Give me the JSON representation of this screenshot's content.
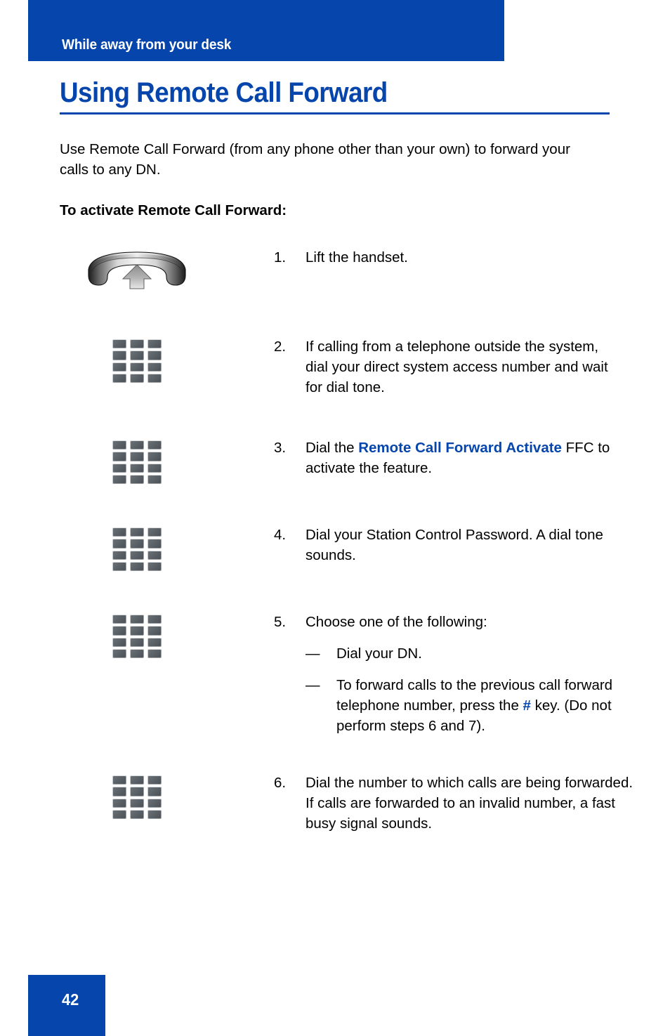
{
  "header": {
    "section_label": "While away from your desk",
    "bar_color": "#0645ab"
  },
  "title": {
    "text": "Using Remote Call Forward",
    "color": "#0645ab"
  },
  "intro": {
    "paragraph": "Use Remote Call Forward (from any phone other than your own) to forward your calls to any DN.",
    "subheading": "To activate Remote Call Forward:"
  },
  "steps": [
    {
      "number": "1.",
      "icon": "handset-lift-icon",
      "text": "Lift the handset."
    },
    {
      "number": "2.",
      "icon": "keypad-icon",
      "text": "If calling from a telephone outside the system, dial your direct system access number and wait for dial tone."
    },
    {
      "number": "3.",
      "icon": "keypad-icon",
      "text_before": "Dial the ",
      "highlight": "Remote Call Forward Activate",
      "text_after": " FFC to activate the feature."
    },
    {
      "number": "4.",
      "icon": "keypad-icon",
      "text": "Dial your Station Control Password. A dial tone sounds."
    },
    {
      "number": "5.",
      "icon": "keypad-icon",
      "text": "Choose one of the following:",
      "sub_items": [
        {
          "dash": "—",
          "text": "Dial your DN."
        },
        {
          "dash": "—",
          "text_before": "To forward calls to the previous call forward telephone number, press the ",
          "highlight": "#",
          "text_after": " key. (Do not perform steps 6 and 7)."
        }
      ]
    },
    {
      "number": "6.",
      "icon": "keypad-icon",
      "text": "Dial the number to which calls are being forwarded. If calls are forwarded to an invalid number, a fast busy signal sounds."
    }
  ],
  "footer": {
    "page_number": "42",
    "box_color": "#0645ab"
  }
}
